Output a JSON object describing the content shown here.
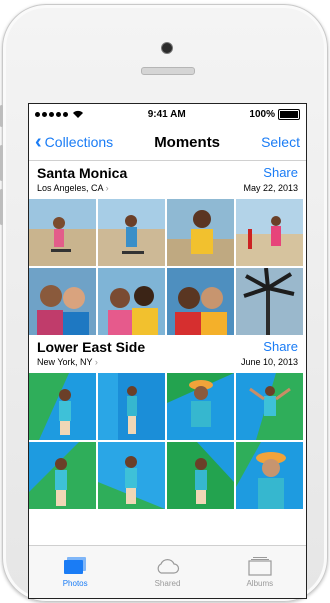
{
  "status": {
    "time": "9:41 AM",
    "battery": "100%"
  },
  "nav": {
    "back_label": "Collections",
    "title": "Moments",
    "action": "Select"
  },
  "moments": [
    {
      "title": "Santa Monica",
      "location": "Los Angeles, CA",
      "share": "Share",
      "date": "May 22, 2013"
    },
    {
      "title": "Lower East Side",
      "location": "New York, NY",
      "share": "Share",
      "date": "June 10, 2013"
    }
  ],
  "tabs": [
    {
      "label": "Photos",
      "icon": "photos-icon"
    },
    {
      "label": "Shared",
      "icon": "cloud-icon"
    },
    {
      "label": "Albums",
      "icon": "albums-icon"
    }
  ],
  "colors": {
    "accent": "#1a7cf5",
    "tab_inactive": "#9a9a9a"
  }
}
